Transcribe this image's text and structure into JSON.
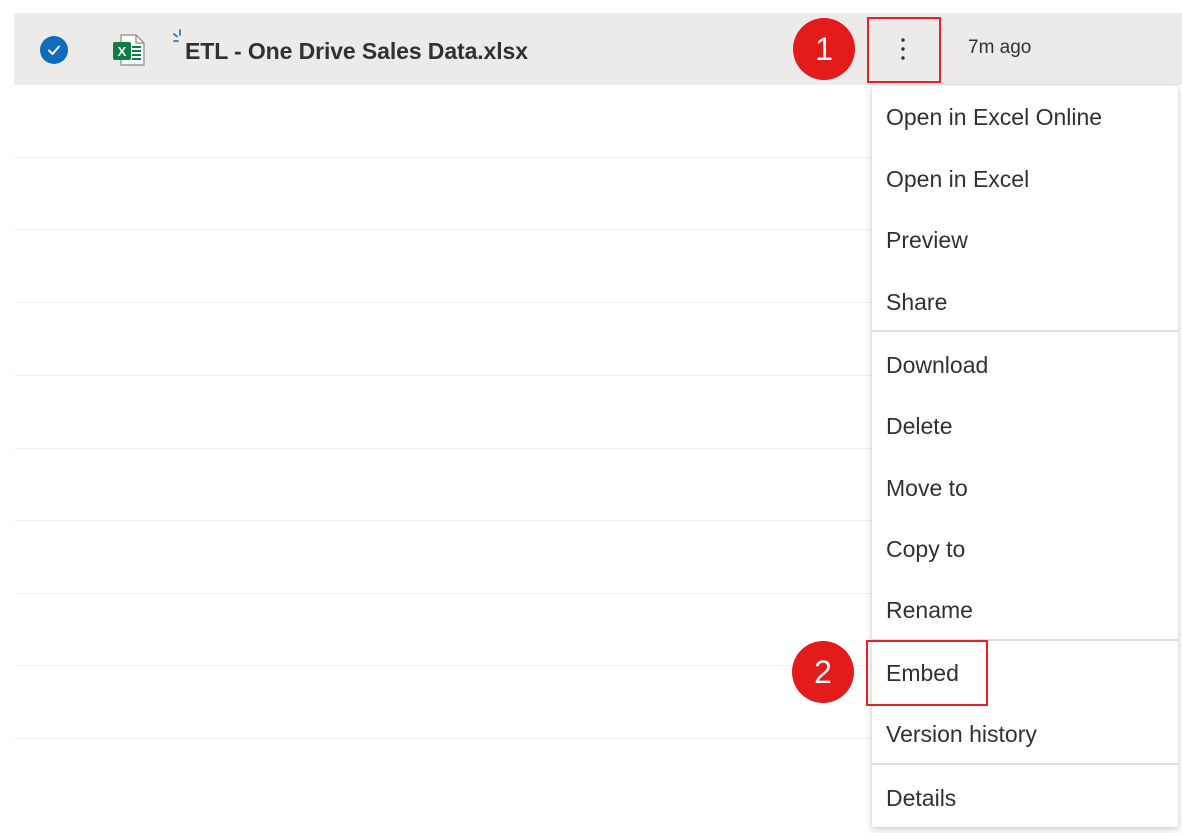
{
  "file_row": {
    "name": "ETL - One Drive Sales Data.xlsx",
    "modified": "7m ago",
    "selected": true,
    "file_icon": "excel-file-icon",
    "more_icon": "more-vertical-icon"
  },
  "context_menu": {
    "items": [
      {
        "label": "Open in Excel Online"
      },
      {
        "label": "Open in Excel"
      },
      {
        "label": "Preview"
      },
      {
        "label": "Share"
      },
      {
        "label": "Download"
      },
      {
        "label": "Delete"
      },
      {
        "label": "Move to"
      },
      {
        "label": "Copy to"
      },
      {
        "label": "Rename"
      },
      {
        "label": "Embed"
      },
      {
        "label": "Version history"
      },
      {
        "label": "Details"
      }
    ]
  },
  "callouts": [
    {
      "number": "1"
    },
    {
      "number": "2"
    }
  ],
  "colors": {
    "accent": "#0f6cbd",
    "excel_green": "#107c41",
    "callout_red": "#e31b1b",
    "row_selected": "#edebe9"
  }
}
